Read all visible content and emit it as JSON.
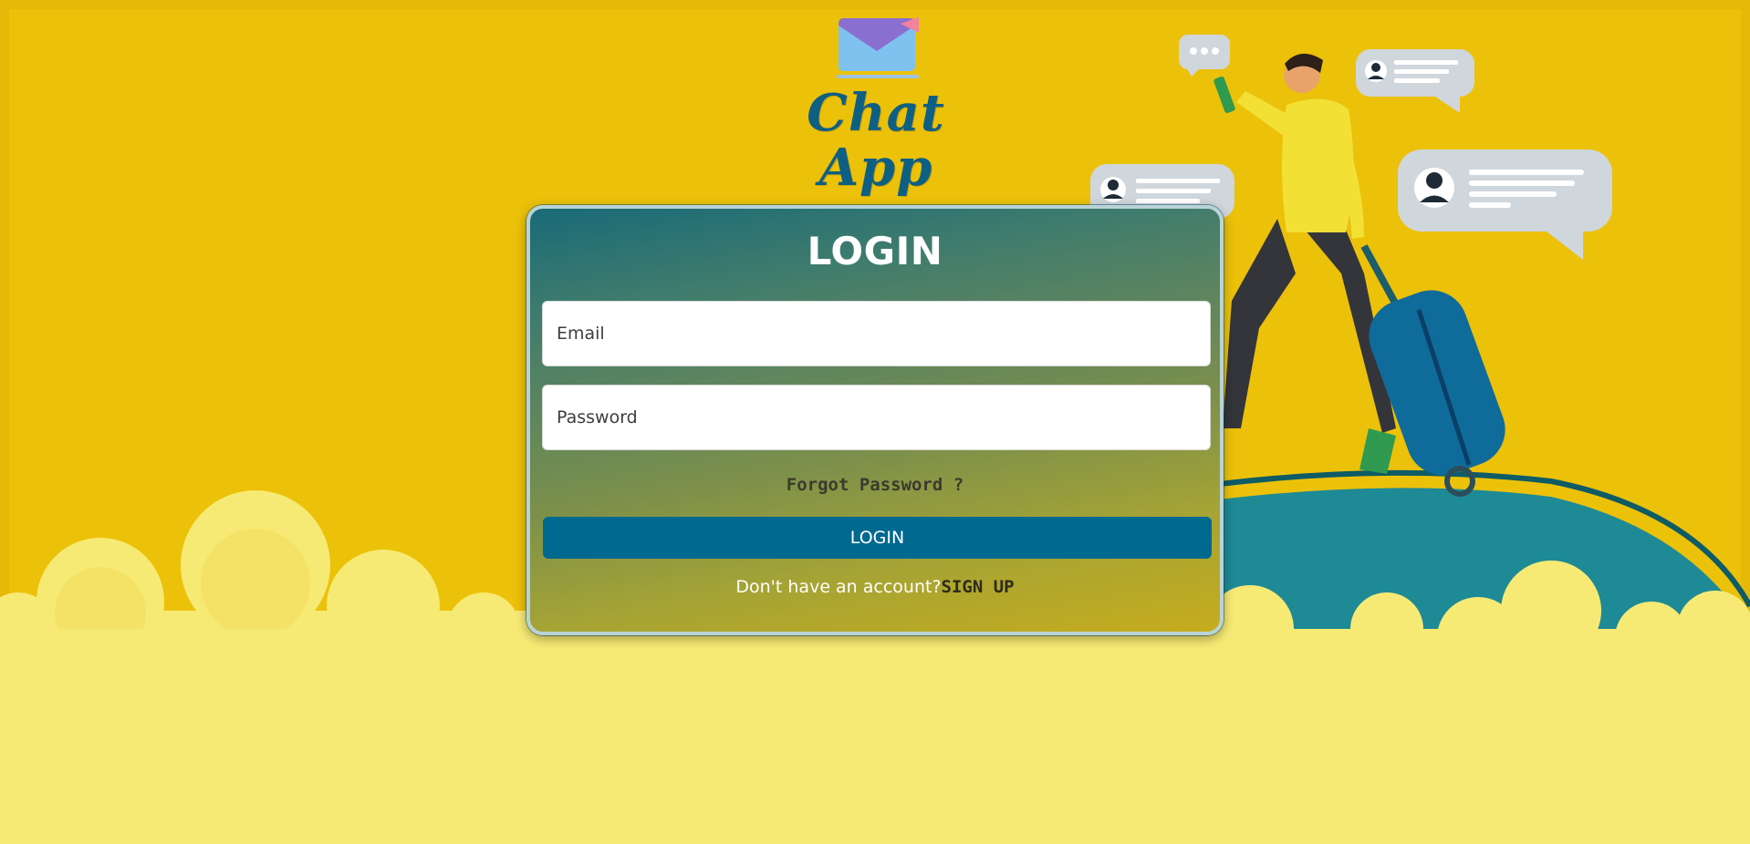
{
  "app": {
    "logo_text": "Chat App",
    "logo_icon": "envelope-icon"
  },
  "login": {
    "title": "LOGIN",
    "email_placeholder": "Email",
    "password_placeholder": "Password",
    "forgot_password": "Forgot Password ?",
    "login_button": "LOGIN",
    "no_account_text": "Don't have an account?",
    "signup_link": "SIGN UP"
  },
  "colors": {
    "background": "#eabf0a",
    "cloud": "#f7ea74",
    "button": "#006990",
    "logo_text": "#0e5f84"
  }
}
